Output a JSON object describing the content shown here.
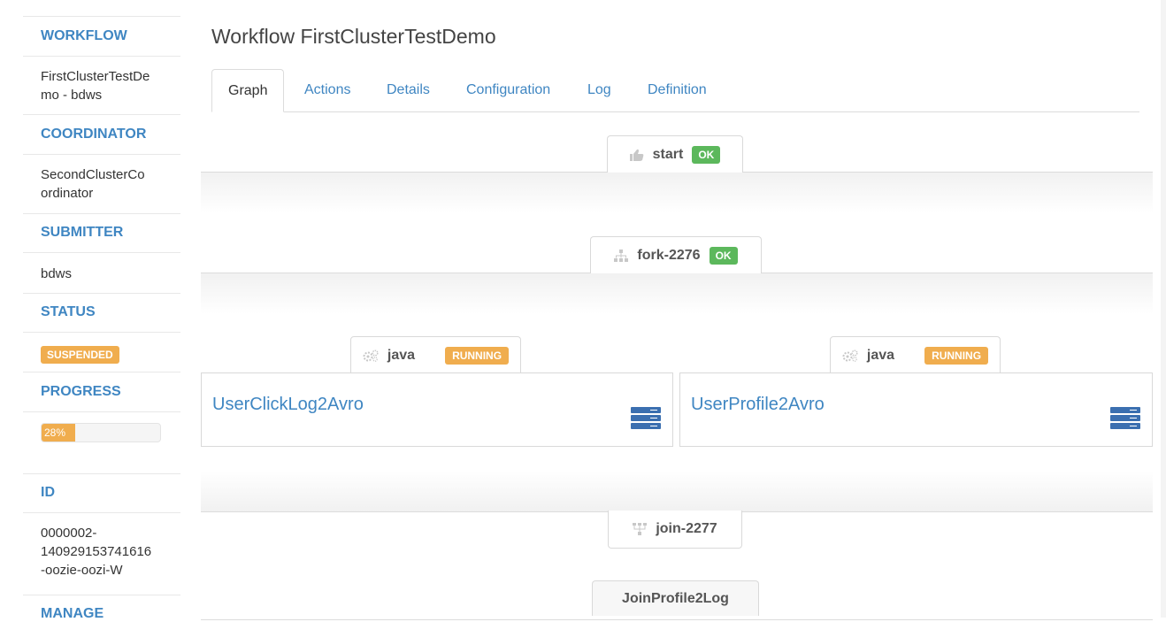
{
  "sidebar": {
    "workflow_label": "WORKFLOW",
    "workflow_value_line1": "FirstClusterTestDe",
    "workflow_value_line2": "mo - bdws",
    "coordinator_label": "COORDINATOR",
    "coordinator_value_line1": "SecondClusterCo",
    "coordinator_value_line2": "ordinator",
    "submitter_label": "SUBMITTER",
    "submitter_value": "bdws",
    "status_label": "STATUS",
    "status_value": "SUSPENDED",
    "progress_label": "PROGRESS",
    "progress_text": "28%",
    "progress_fraction": 0.28,
    "id_label": "ID",
    "id_line1": "0000002-",
    "id_line2": "140929153741616",
    "id_line3": "-oozie-oozi-W",
    "manage_label": "MANAGE"
  },
  "header": {
    "title": "Workflow FirstClusterTestDemo"
  },
  "tabs": [
    {
      "label": "Graph",
      "active": true
    },
    {
      "label": "Actions"
    },
    {
      "label": "Details"
    },
    {
      "label": "Configuration"
    },
    {
      "label": "Log"
    },
    {
      "label": "Definition"
    }
  ],
  "graph": {
    "start": {
      "name": "start",
      "status": "OK",
      "icon": "thumbs-up-icon"
    },
    "fork": {
      "name": "fork-2276",
      "status": "OK",
      "icon": "sitemap-icon"
    },
    "actions": [
      {
        "type": "java",
        "status": "RUNNING",
        "name": "UserClickLog2Avro",
        "icon": "cogs-icon"
      },
      {
        "type": "java",
        "status": "RUNNING",
        "name": "UserProfile2Avro",
        "icon": "cogs-icon"
      }
    ],
    "join": {
      "name": "join-2277",
      "icon": "join-icon"
    },
    "next": {
      "name": "JoinProfile2Log"
    }
  },
  "colors": {
    "link": "#3f86c2",
    "ok": "#5cb85c",
    "warning": "#f0ad4e"
  }
}
